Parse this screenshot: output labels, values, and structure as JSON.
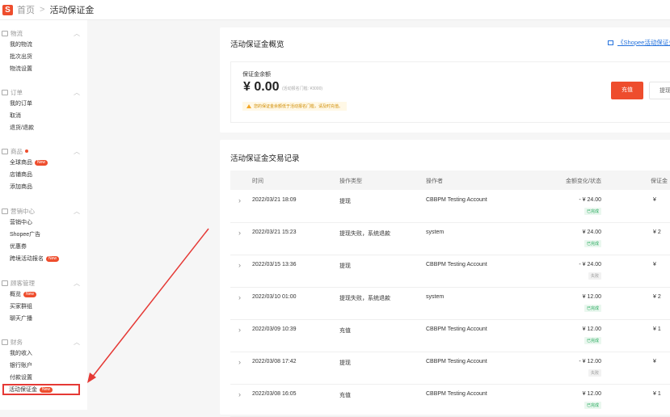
{
  "header": {
    "logo": "S",
    "home": "首页",
    "sep": ">",
    "current": "活动保证金"
  },
  "sidebar": {
    "sections": [
      {
        "title": "物流",
        "items": [
          "我的物流",
          "批次出货",
          "物流设置"
        ]
      },
      {
        "title": "订单",
        "items": [
          "我的订单",
          "取消",
          "退货/退款"
        ]
      },
      {
        "title": "商品",
        "items": [
          "全球商品",
          "店铺商品",
          "添加商品"
        ]
      },
      {
        "title": "营销中心",
        "items": [
          "营销中心",
          "Shopee广告",
          "优惠券",
          "跨境活动报名"
        ]
      },
      {
        "title": "顾客管理",
        "items": [
          "概览",
          "买家群组",
          "聊天广播"
        ]
      },
      {
        "title": "财务",
        "items": [
          "我的收入",
          "银行账户",
          "付款设置",
          "活动保证金"
        ]
      }
    ],
    "new_badge": "New"
  },
  "overview": {
    "title": "活动保证金概览",
    "guide_link": "《Shopee活动保证金",
    "balance_label": "保证金余额",
    "balance_amount": "¥ 0.00",
    "threshold_note": "(活动报名门槛: ¥3000)",
    "warning": "您的保证金余额低于活动报名门槛，请及时充值。",
    "topup_button": "充值",
    "withdraw_button": "提现"
  },
  "records": {
    "title": "活动保证金交易记录",
    "columns": {
      "time": "时间",
      "type": "操作类型",
      "operator": "操作者",
      "change": "金额变化/状态",
      "balance": "保证金"
    },
    "rows": [
      {
        "time": "2022/03/21 18:09",
        "type": "提现",
        "operator": "CBBPM Testing Account",
        "amount": "- ¥ 24.00",
        "status": "已完成",
        "ok": true,
        "balance": "¥"
      },
      {
        "time": "2022/03/21 15:23",
        "type": "提现失败，系统退款",
        "operator": "system",
        "amount": "¥ 24.00",
        "status": "已完成",
        "ok": true,
        "balance": "¥ 2"
      },
      {
        "time": "2022/03/15 13:36",
        "type": "提现",
        "operator": "CBBPM Testing Account",
        "amount": "- ¥ 24.00",
        "status": "失败",
        "ok": false,
        "balance": "¥"
      },
      {
        "time": "2022/03/10 01:00",
        "type": "提现失败，系统退款",
        "operator": "system",
        "amount": "¥ 12.00",
        "status": "已完成",
        "ok": true,
        "balance": "¥ 2"
      },
      {
        "time": "2022/03/09 10:39",
        "type": "充值",
        "operator": "CBBPM Testing Account",
        "amount": "¥ 12.00",
        "status": "已完成",
        "ok": true,
        "balance": "¥ 1"
      },
      {
        "time": "2022/03/08 17:42",
        "type": "提现",
        "operator": "CBBPM Testing Account",
        "amount": "- ¥ 12.00",
        "status": "失败",
        "ok": false,
        "balance": "¥"
      },
      {
        "time": "2022/03/08 16:05",
        "type": "充值",
        "operator": "CBBPM Testing Account",
        "amount": "¥ 12.00",
        "status": "已完成",
        "ok": true,
        "balance": "¥ 1"
      }
    ]
  },
  "colors": {
    "accent": "#ee4d2d",
    "annotation": "#e53935",
    "link": "#2673dd",
    "success": "#26aa5c"
  }
}
